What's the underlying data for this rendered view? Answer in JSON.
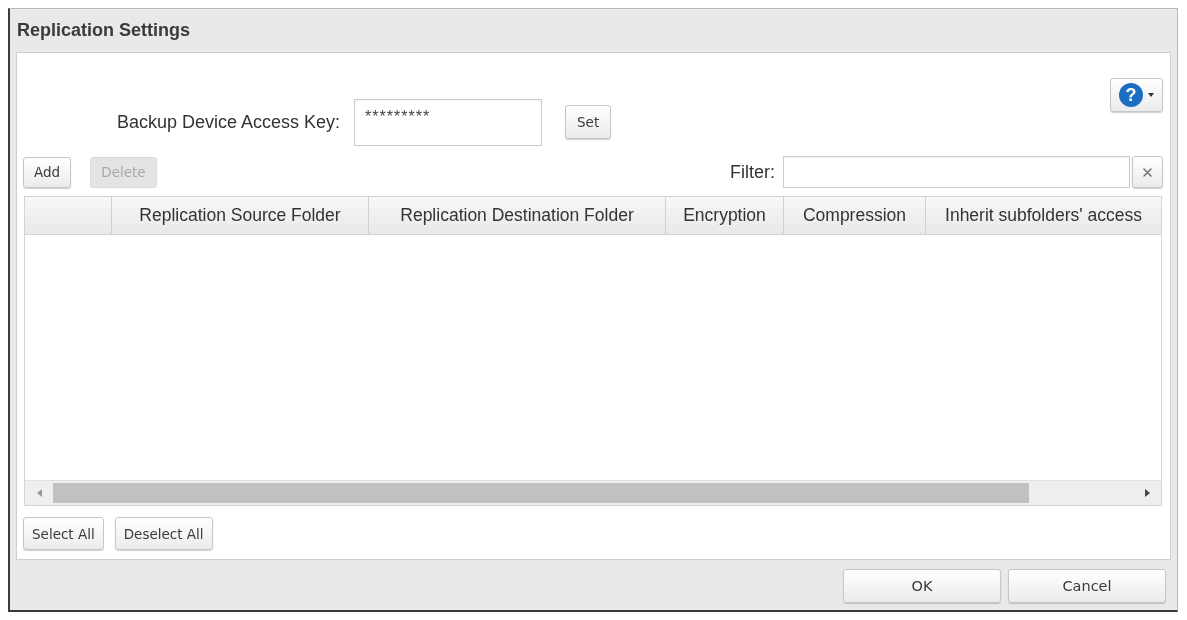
{
  "window": {
    "title": "Replication Settings"
  },
  "help_button": {
    "symbol": "?"
  },
  "access_key": {
    "label": "Backup Device Access Key:",
    "value": "*********",
    "button": "Set"
  },
  "toolbar": {
    "buttons": [
      {
        "label": "Add",
        "disabled": false
      },
      {
        "label": "Delete",
        "disabled": true
      }
    ]
  },
  "filter": {
    "label": "Filter:"
  },
  "table": {
    "columns": [
      "Replication Source Folder",
      "Replication Destination Folder",
      "Encryption",
      "Compression",
      "Inherit subfolders' access"
    ]
  },
  "selection_buttons": [
    "Select All",
    "Deselect All"
  ],
  "dialog_buttons": [
    "OK",
    "Cancel"
  ]
}
